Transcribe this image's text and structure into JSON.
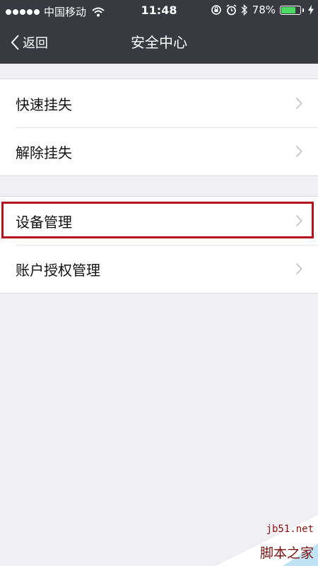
{
  "status_bar": {
    "carrier": "中国移动",
    "time": "11:48",
    "battery_percent": "78%",
    "battery_level": 0.78,
    "icons": [
      "signal-dots-icon",
      "wifi-icon",
      "rotation-lock-icon",
      "alarm-icon",
      "bluetooth-icon",
      "battery-icon",
      "charging-icon"
    ]
  },
  "navbar": {
    "back_label": "返回",
    "title": "安全中心"
  },
  "groups": [
    {
      "items": [
        {
          "label": "快速挂失"
        },
        {
          "label": "解除挂失"
        }
      ]
    },
    {
      "items": [
        {
          "label": "设备管理",
          "highlighted": true
        },
        {
          "label": "账户授权管理"
        }
      ]
    }
  ],
  "colors": {
    "navbar_bg": "#393a3f",
    "page_bg": "#efeff4",
    "highlight_border": "#b4121c",
    "battery_fill": "#4cd964"
  },
  "watermark": {
    "url": "jb51.net",
    "name": "脚本之家"
  }
}
